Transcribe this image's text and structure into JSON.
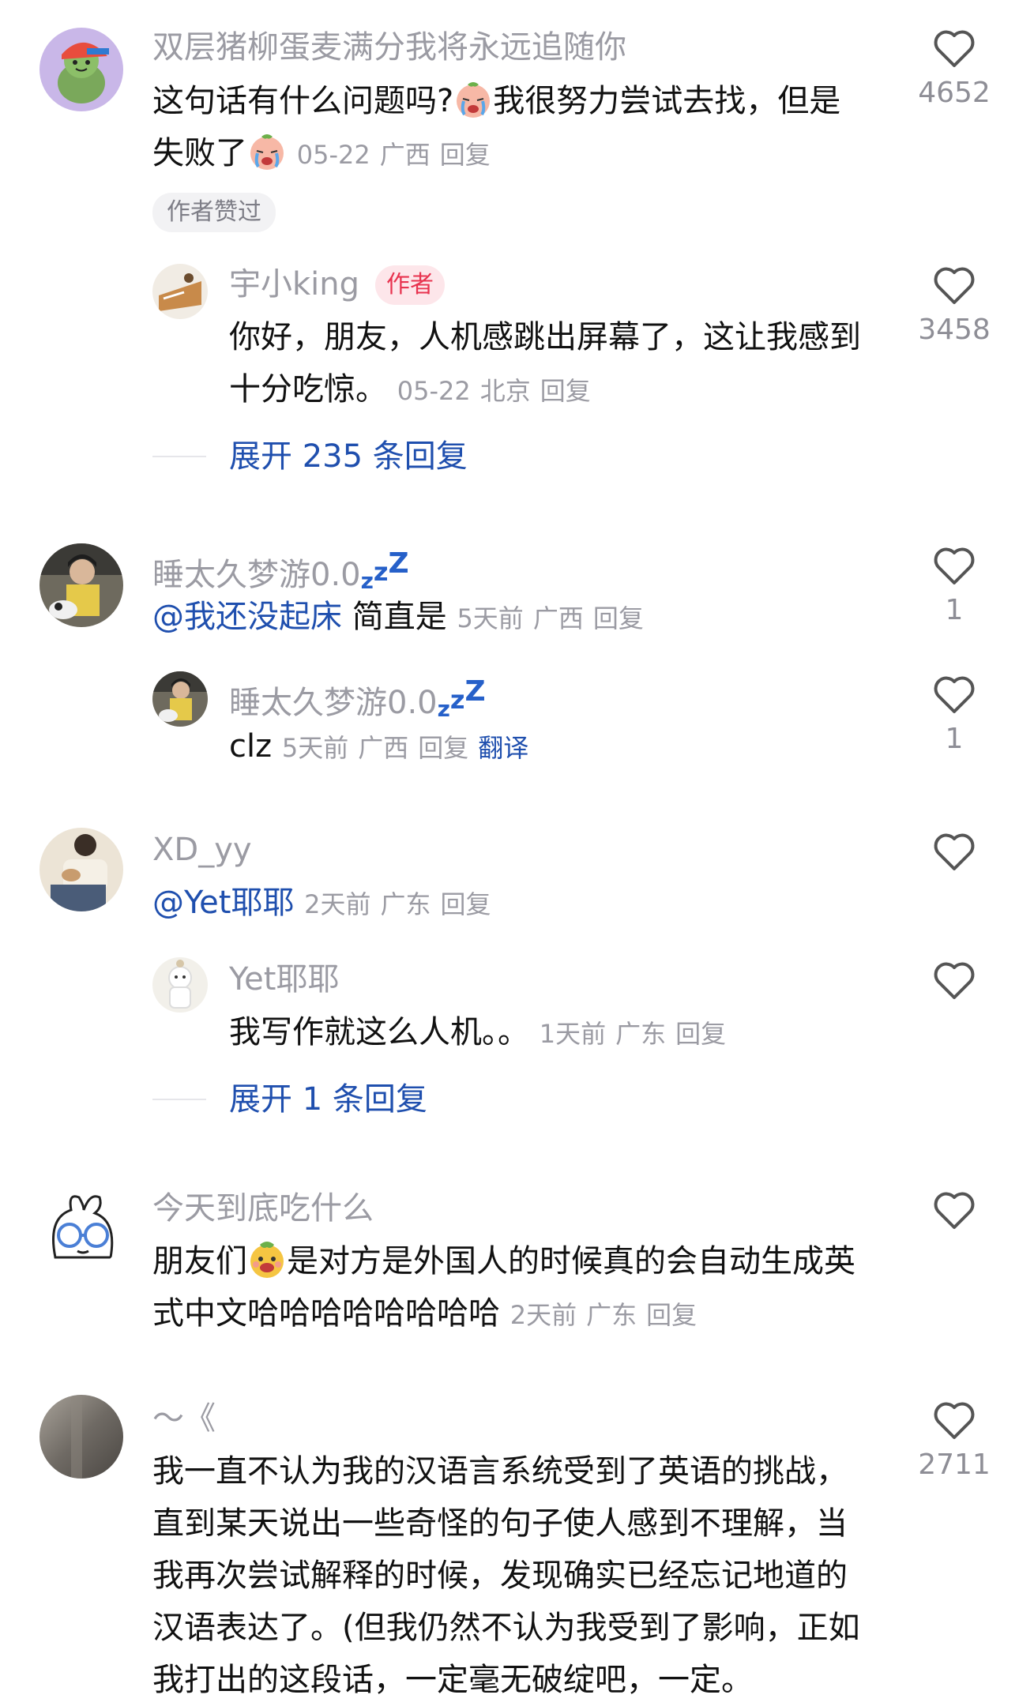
{
  "comments": [
    {
      "username": "双层猪柳蛋麦满分我将永远追随你",
      "text_1": "这句话有什么问题吗?",
      "text_2": "我很努力尝试去找，但是",
      "text_3": "失败了",
      "date": "05-22",
      "location": "广西",
      "reply_label": "回复",
      "likes": "4652",
      "liked_by_author": "作者赞过",
      "replies": [
        {
          "username": "宇小king",
          "badge": "作者",
          "text_1": "你好，朋友，人机感跳出屏幕了，这让我感到",
          "text_2": "十分吃惊。",
          "date": "05-22",
          "location": "北京",
          "reply_label": "回复",
          "likes": "3458"
        }
      ],
      "expand_label": "展开 235 条回复"
    },
    {
      "username": "睡太久梦游0.0",
      "mention": "@我还没起床",
      "text_1": "简直是",
      "date": "5天前",
      "location": "广西",
      "reply_label": "回复",
      "likes": "1",
      "replies": [
        {
          "username": "睡太久梦游0.0",
          "text_1": "clz",
          "date": "5天前",
          "location": "广西",
          "reply_label": "回复",
          "translate_label": "翻译",
          "likes": "1"
        }
      ]
    },
    {
      "username": "XD_yy",
      "mention": "@Yet耶耶",
      "date": "2天前",
      "location": "广东",
      "reply_label": "回复",
      "replies": [
        {
          "username": "Yet耶耶",
          "text_1": "我写作就这么人机。。",
          "date": "1天前",
          "location": "广东",
          "reply_label": "回复"
        }
      ],
      "expand_label": "展开 1 条回复"
    },
    {
      "username": "今天到底吃什么",
      "text_1": "朋友们",
      "text_2": "是对方是外国人的时候真的会自动生成英",
      "text_3": "式中文哈哈哈哈哈哈哈哈",
      "date": "2天前",
      "location": "广东",
      "reply_label": "回复"
    },
    {
      "username": "～《",
      "lines": [
        "我一直不认为我的汉语言系统受到了英语的挑战，",
        "直到某天说出一些奇怪的句子使人感到不理解，当",
        "我再次尝试解释的时候，发现确实已经忘记地道的",
        "汉语表达了。(但我仍然不认为我受到了影响，正如",
        "我打出的这段话，一定毫无破绽吧，一定。"
      ],
      "likes": "2711"
    }
  ],
  "icons": {
    "like": "heart-outline-icon",
    "emoji_cry": "crying-face-emoji",
    "emoji_grin": "grinning-face-emoji",
    "zz": "sleep-zzz-icon"
  },
  "colors": {
    "username": "#9b9ba3",
    "meta": "#9b9ba3",
    "link": "#1f4fae",
    "author_badge_bg": "#fde6ea",
    "author_badge_text": "#e8334f",
    "zzz": "#2660c9"
  }
}
